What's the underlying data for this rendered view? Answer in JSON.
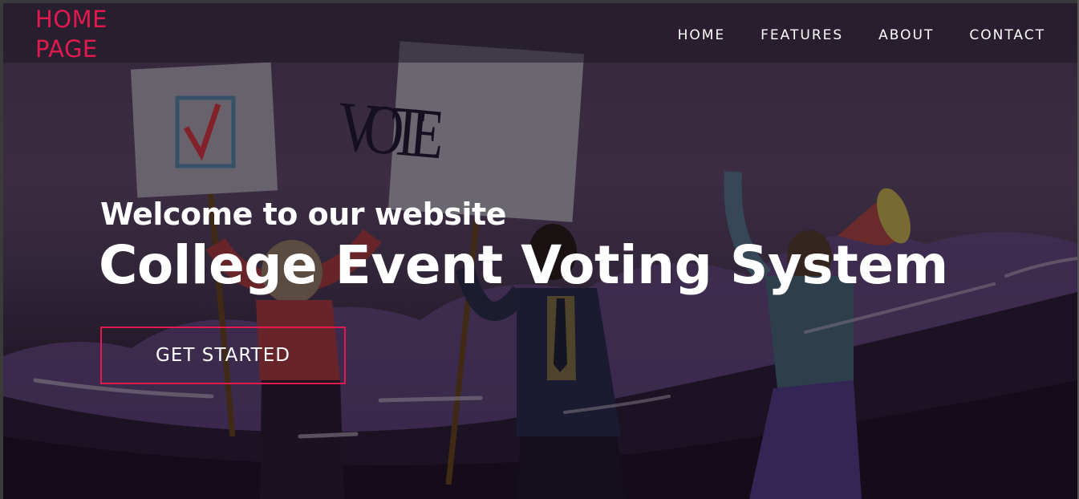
{
  "brand": {
    "logo_line1": "HOME",
    "logo_line2": "PAGE",
    "accent_color": "#e01a4f"
  },
  "nav": {
    "items": [
      {
        "label": "HOME"
      },
      {
        "label": "FEATURES"
      },
      {
        "label": "ABOUT"
      },
      {
        "label": "CONTACT"
      }
    ]
  },
  "hero": {
    "welcome": "Welcome to our website",
    "title": "College Event Voting System",
    "cta_label": "GET STARTED",
    "sign_text": "VOTE"
  }
}
